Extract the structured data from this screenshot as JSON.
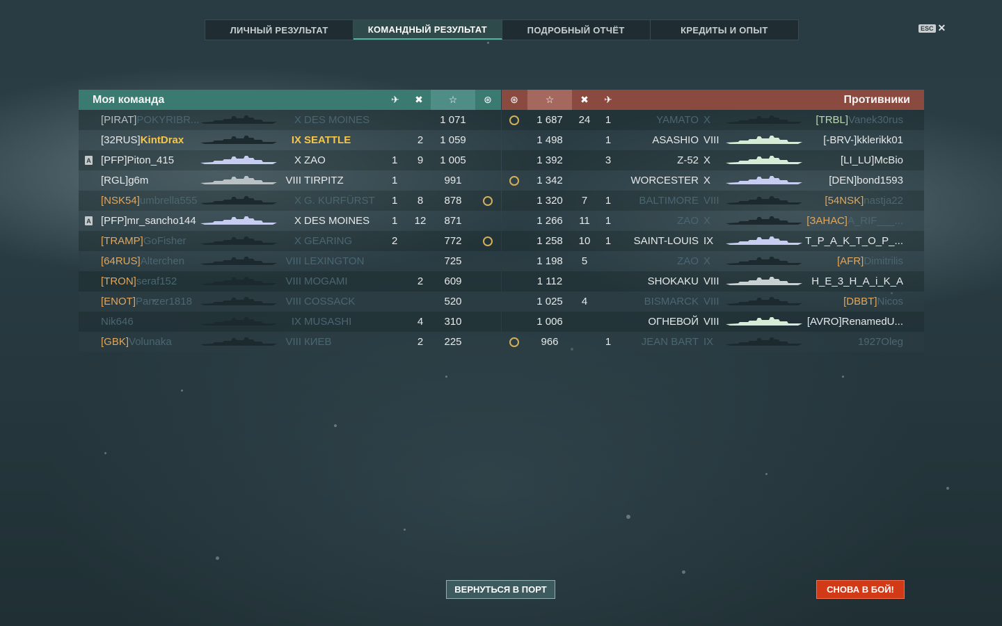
{
  "tabs": [
    {
      "label": "ЛИЧНЫЙ РЕЗУЛЬТАТ",
      "active": false
    },
    {
      "label": "КОМАНДНЫЙ РЕЗУЛЬТАТ",
      "active": true
    },
    {
      "label": "ПОДРОБНЫЙ ОТЧЁТ",
      "active": false
    },
    {
      "label": "КРЕДИТЫ И ОПЫТ",
      "active": false
    }
  ],
  "esc_label": "ESC",
  "my_team": {
    "title": "Моя команда",
    "columns": [
      "planes-destroyed-icon",
      "ships-destroyed-icon",
      "experience-star-icon",
      "achievement-icon"
    ],
    "rows": [
      {
        "tag": "[PIRAT]",
        "name": "POKYRIBR...",
        "tier": "X",
        "ship": "DES MOINES",
        "planes": "",
        "kills": "",
        "xp": "1 071",
        "medal": false,
        "badge": "",
        "state": "dead"
      },
      {
        "tag": "[32RUS]",
        "name": "KintDrax",
        "tier": "IX",
        "ship": "SEATTLE",
        "planes": "",
        "kills": "2",
        "xp": "1 059",
        "medal": false,
        "badge": "",
        "state": "self"
      },
      {
        "tag": "[PFP]",
        "name": "Piton_415",
        "tier": "X",
        "ship": "ZAO",
        "planes": "1",
        "kills": "9",
        "xp": "1 005",
        "medal": false,
        "badge": "A",
        "state": "alive"
      },
      {
        "tag": "[RGL]",
        "name": "g6m",
        "tier": "VIII",
        "ship": "TIRPITZ",
        "planes": "1",
        "kills": "",
        "xp": "991",
        "medal": false,
        "badge": "",
        "state": "alive"
      },
      {
        "tag": "[NSK54]",
        "name": "umbrella555",
        "tier": "X",
        "ship": "G. KURFÜRST",
        "planes": "1",
        "kills": "8",
        "xp": "878",
        "medal": true,
        "badge": "",
        "state": "dead"
      },
      {
        "tag": "[PFP]",
        "name": "mr_sancho144",
        "tier": "X",
        "ship": "DES MOINES",
        "planes": "1",
        "kills": "12",
        "xp": "871",
        "medal": false,
        "badge": "A",
        "state": "alive"
      },
      {
        "tag": "[TRAMP]",
        "name": "GoFisher",
        "tier": "X",
        "ship": "GEARING",
        "planes": "2",
        "kills": "",
        "xp": "772",
        "medal": true,
        "badge": "",
        "state": "dead"
      },
      {
        "tag": "[64RUS]",
        "name": "Alterchen",
        "tier": "VIII",
        "ship": "LEXINGTON",
        "planes": "",
        "kills": "",
        "xp": "725",
        "medal": false,
        "badge": "",
        "state": "dead"
      },
      {
        "tag": "[TRON]",
        "name": "seraf152",
        "tier": "VIII",
        "ship": "MOGAMI",
        "planes": "",
        "kills": "2",
        "xp": "609",
        "medal": false,
        "badge": "",
        "state": "dead"
      },
      {
        "tag": "[ENOT]",
        "name": "Panzer1818",
        "tier": "VIII",
        "ship": "COSSACK",
        "planes": "",
        "kills": "",
        "xp": "520",
        "medal": false,
        "badge": "",
        "state": "dead"
      },
      {
        "tag": "",
        "name": "Nik646",
        "tier": "IX",
        "ship": "MUSASHI",
        "planes": "",
        "kills": "4",
        "xp": "310",
        "medal": false,
        "badge": "",
        "state": "dead"
      },
      {
        "tag": "[GBK]",
        "name": "Volunaka",
        "tier": "VIII",
        "ship": "КИЕВ",
        "planes": "",
        "kills": "2",
        "xp": "225",
        "medal": false,
        "badge": "",
        "state": "dead"
      }
    ]
  },
  "enemy_team": {
    "title": "Противники",
    "columns": [
      "achievement-icon",
      "experience-star-icon",
      "ships-destroyed-icon",
      "planes-destroyed-icon"
    ],
    "rows": [
      {
        "medal": true,
        "xp": "1 687",
        "kills": "24",
        "planes": "1",
        "ship": "YAMATO",
        "tier": "X",
        "tag": "[TRBL]",
        "name": "Vanek30rus",
        "state": "dead"
      },
      {
        "medal": false,
        "xp": "1 498",
        "kills": "",
        "planes": "1",
        "ship": "ASASHIO",
        "tier": "VIII",
        "tag": "[-BRV-]",
        "name": "kklerikk01",
        "state": "alive"
      },
      {
        "medal": false,
        "xp": "1 392",
        "kills": "",
        "planes": "3",
        "ship": "Z-52",
        "tier": "X",
        "tag": "[LI_LU]",
        "name": "McBio",
        "state": "alive"
      },
      {
        "medal": true,
        "xp": "1 342",
        "kills": "",
        "planes": "",
        "ship": "WORCESTER",
        "tier": "X",
        "tag": "[DEN]",
        "name": "bond1593",
        "state": "alive"
      },
      {
        "medal": false,
        "xp": "1 320",
        "kills": "7",
        "planes": "1",
        "ship": "BALTIMORE",
        "tier": "VIII",
        "tag": "[54NSK]",
        "name": "nastja22",
        "state": "dead"
      },
      {
        "medal": false,
        "xp": "1 266",
        "kills": "11",
        "planes": "1",
        "ship": "ZAO",
        "tier": "X",
        "tag": "[ЗАНАС]",
        "name": "A_RIF___...",
        "state": "dead"
      },
      {
        "medal": false,
        "xp": "1 258",
        "kills": "10",
        "planes": "1",
        "ship": "SAINT-LOUIS",
        "tier": "IX",
        "tag": "",
        "name": "T_P_A_K_T_O_P_...",
        "state": "alive"
      },
      {
        "medal": false,
        "xp": "1 198",
        "kills": "5",
        "planes": "",
        "ship": "ZAO",
        "tier": "X",
        "tag": "[AFR]",
        "name": "Dimitrilis",
        "state": "dead"
      },
      {
        "medal": false,
        "xp": "1 112",
        "kills": "",
        "planes": "",
        "ship": "SHOKAKU",
        "tier": "VIII",
        "tag": "",
        "name": "H_E_3_H_A_i_K_A",
        "state": "alive"
      },
      {
        "medal": false,
        "xp": "1 025",
        "kills": "4",
        "planes": "",
        "ship": "BISMARCK",
        "tier": "VIII",
        "tag": "[DBBT]",
        "name": "Nicos",
        "state": "dead"
      },
      {
        "medal": false,
        "xp": "1 006",
        "kills": "",
        "planes": "",
        "ship": "ОГНЕВОЙ",
        "tier": "VIII",
        "tag": "[AVRO]",
        "name": "RenamedU...",
        "state": "alive"
      },
      {
        "medal": true,
        "xp": "966",
        "kills": "",
        "planes": "1",
        "ship": "JEAN BART",
        "tier": "IX",
        "tag": "",
        "name": "1927Oleg",
        "state": "dead"
      }
    ]
  },
  "buttons": {
    "port": "ВЕРНУТЬСЯ В ПОРТ",
    "battle": "СНОВА В БОЙ!"
  },
  "colors": {
    "my_team_header": "#3a7a70",
    "enemy_header": "#8a4a40",
    "battle_button": "#d23a17",
    "clan_tag": "#e0a75e",
    "self_name": "#f5c64a"
  }
}
